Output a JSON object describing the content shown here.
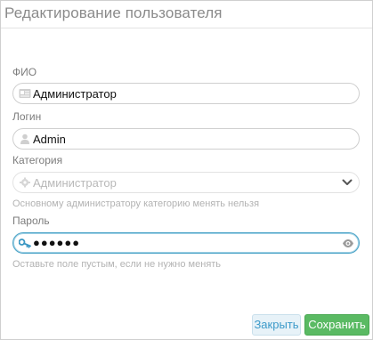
{
  "dialog": {
    "title": "Редактирование пользователя"
  },
  "form": {
    "fio": {
      "label": "ФИО",
      "value": "Администратор",
      "icon": "id-card-icon"
    },
    "login": {
      "label": "Логин",
      "value": "Admin",
      "icon": "user-icon"
    },
    "category": {
      "label": "Категория",
      "value": "Администратор",
      "icon": "gear-icon",
      "hint": "Основному администратору категорию менять нельзя"
    },
    "password": {
      "label": "Пароль",
      "masked_value": "●●●●●●",
      "icon": "key-icon",
      "hint": "Оставьте поле пустым, если не нужно менять"
    }
  },
  "buttons": {
    "close_label": "Закрыть",
    "save_label": "Сохранить"
  },
  "colors": {
    "accent": "#4aa3c7",
    "save": "#5aba63",
    "close_text": "#3c9ac9",
    "hint": "#b3b3b3"
  }
}
